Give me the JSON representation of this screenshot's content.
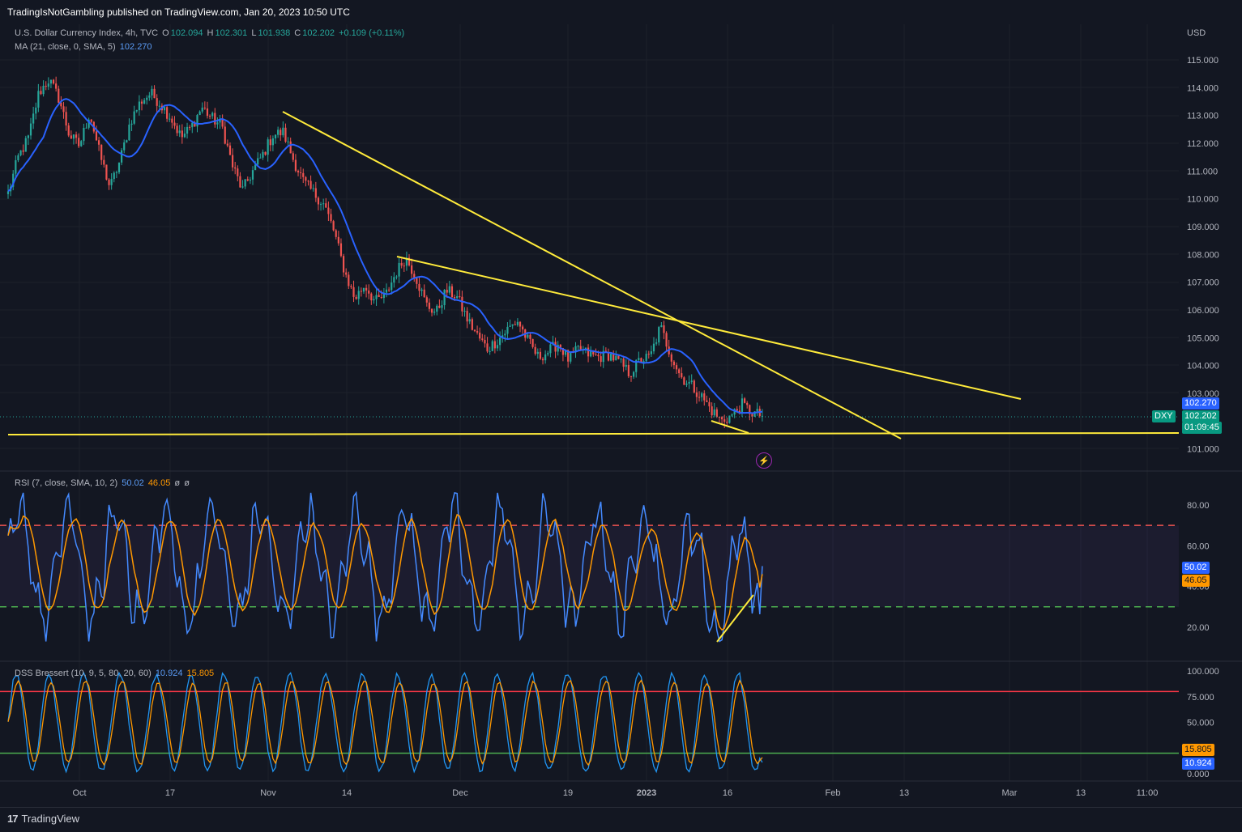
{
  "header": {
    "publish_info": "TradingIsNotGambling published on TradingView.com, Jan 20, 2023 10:50 UTC"
  },
  "main_legend": {
    "symbol": "U.S. Dollar Currency Index, 4h, TVC",
    "o_label": "O",
    "o_value": "102.094",
    "h_label": "H",
    "h_value": "102.301",
    "l_label": "L",
    "l_value": "101.938",
    "c_label": "C",
    "c_value": "102.202",
    "change": "+0.109 (+0.11%)",
    "ma_label": "MA (21, close, 0, SMA, 5)",
    "ma_value": "102.270"
  },
  "rsi_legend": {
    "label": "RSI (7, close, SMA, 10, 2)",
    "value1": "50.02",
    "value2": "46.05",
    "extra1": "ø",
    "extra2": "ø"
  },
  "dss_legend": {
    "label": "DSS Bressert (10, 9, 5, 80, 20, 60)",
    "value1": "10.924",
    "value2": "15.805"
  },
  "price_tags": {
    "currency": "USD",
    "ma": "102.270",
    "symbol": "DXY",
    "close": "102.202",
    "countdown": "01:09:45"
  },
  "rsi_tags": {
    "rsi": "50.02",
    "sma": "46.05"
  },
  "dss_tags": {
    "v2": "15.805",
    "v1": "10.924"
  },
  "footer": {
    "brand": "TradingView"
  },
  "colors": {
    "background": "#131722",
    "up": "#26a69a",
    "down": "#ef5350",
    "ma": "#2962ff",
    "trendline": "#ffeb3b",
    "rsi": "#448aff",
    "rsi_sma": "#ff9800",
    "dss1": "#2196f3",
    "dss2": "#ff9800"
  },
  "chart_data": [
    {
      "type": "candlestick",
      "title": "U.S. Dollar Currency Index, 4h, TVC",
      "ylim": [
        100.5,
        115.5
      ],
      "y_ticks": [
        "115.000",
        "114.000",
        "113.000",
        "112.000",
        "111.000",
        "110.000",
        "109.000",
        "108.000",
        "107.000",
        "106.000",
        "105.000",
        "104.000",
        "103.000",
        "101.000"
      ],
      "x_ticks": [
        "Oct",
        "17",
        "Nov",
        "14",
        "Dec",
        "19",
        "2023",
        "16",
        "Feb",
        "13",
        "Mar",
        "13",
        "11:00"
      ],
      "close_path": [
        110.2,
        111.5,
        112.2,
        113.8,
        114.3,
        113.6,
        112.3,
        111.9,
        113.1,
        111.6,
        110.4,
        111.4,
        112.8,
        113.5,
        113.8,
        113.4,
        112.9,
        112.2,
        112.6,
        113.3,
        112.9,
        112.6,
        111.2,
        110.3,
        111.0,
        111.6,
        112.3,
        112.4,
        111.4,
        110.6,
        110.2,
        109.8,
        108.8,
        107.4,
        106.4,
        106.9,
        106.3,
        106.5,
        107.3,
        107.9,
        107.2,
        106.2,
        105.9,
        106.7,
        106.5,
        105.7,
        105.1,
        104.6,
        104.9,
        105.3,
        105.6,
        104.9,
        104.3,
        104.5,
        104.8,
        104.2,
        104.6,
        104.4,
        104.3,
        104.4,
        104.1,
        103.7,
        104.2,
        104.3,
        105.4,
        104.4,
        103.6,
        103.3,
        102.9,
        102.4,
        102.0,
        102.2,
        102.6,
        102.3,
        102.2
      ],
      "ma_series_name": "MA (21, close, 0, SMA, 5)",
      "trendlines": [
        {
          "from_date": "Nov 3",
          "from_price": 113.1,
          "to_date": "Feb 10",
          "to_price": 101.4
        },
        {
          "from_date": "Nov 21",
          "from_price": 107.9,
          "to_date": "Mar 3",
          "to_price": 102.8
        },
        {
          "from_date": "Sep 19",
          "from_price": 101.4,
          "to_date": "Mar 31",
          "to_price": 101.45
        },
        {
          "from_date": "Jan 12",
          "from_price": 101.9,
          "to_date": "Jan 17",
          "to_price": 101.5
        }
      ]
    },
    {
      "type": "line",
      "title": "RSI (7, close, SMA, 10, 2)",
      "ylim": [
        10,
        90
      ],
      "y_ticks": [
        "80.00",
        "60.00",
        "40.00",
        "20.00"
      ],
      "bands": {
        "upper": 70,
        "lower": 30
      },
      "series": [
        {
          "name": "RSI",
          "last": 50.02
        },
        {
          "name": "SMA",
          "last": 46.05
        }
      ]
    },
    {
      "type": "line",
      "title": "DSS Bressert (10, 9, 5, 80, 20, 60)",
      "ylim": [
        0,
        100
      ],
      "y_ticks": [
        "100.000",
        "75.000",
        "50.000",
        "25.000",
        "0.000"
      ],
      "levels": {
        "overbought": 80,
        "oversold": 20
      },
      "series": [
        {
          "name": "DSS",
          "last": 10.924
        },
        {
          "name": "Signal",
          "last": 15.805
        }
      ]
    }
  ]
}
